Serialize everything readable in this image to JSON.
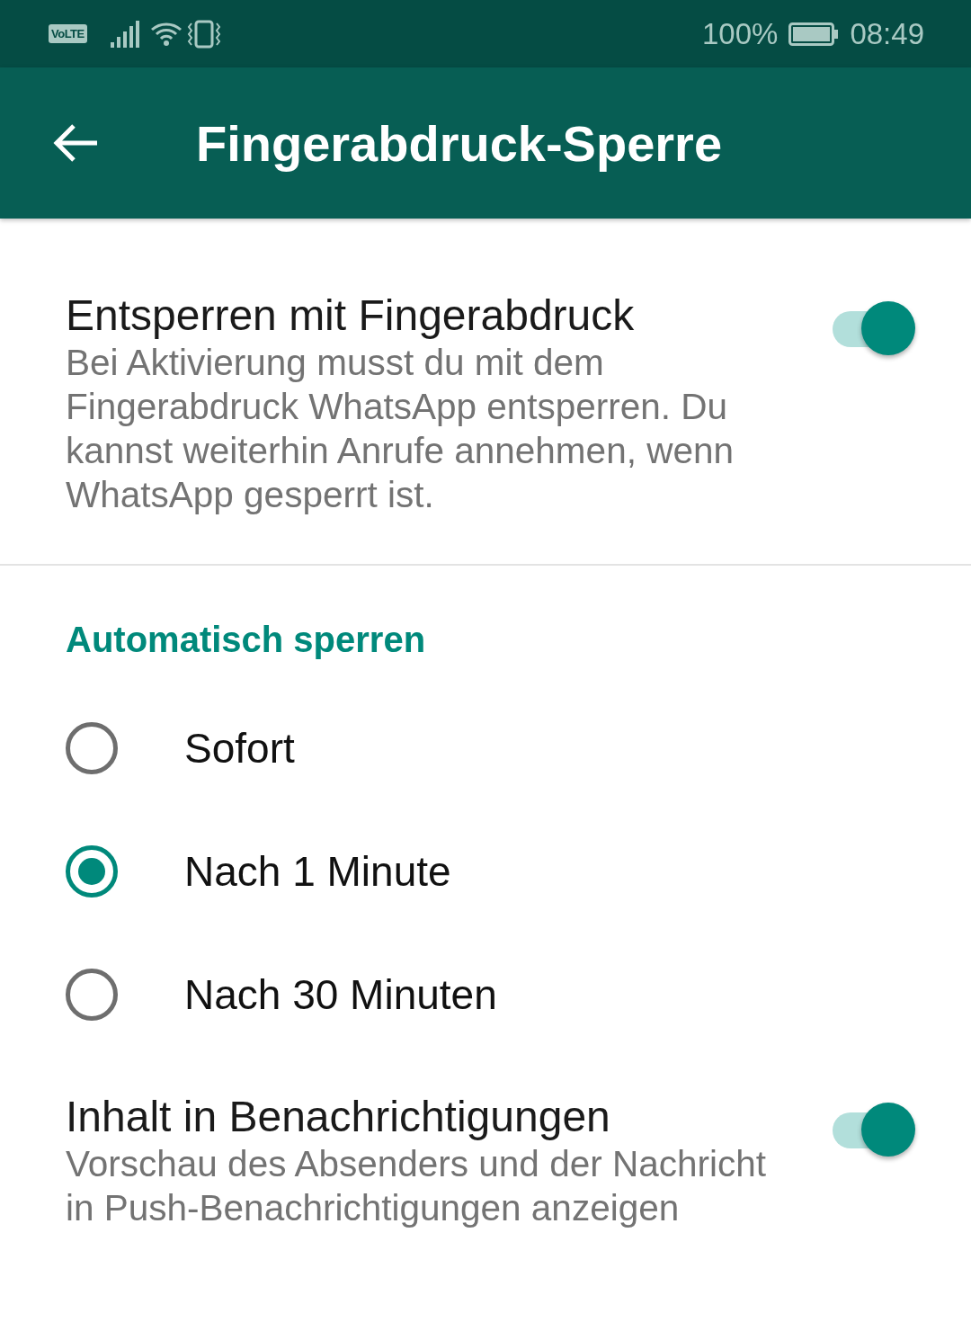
{
  "status_bar": {
    "network_badge": "VoLTE",
    "battery": "100%",
    "time": "08:49"
  },
  "app_bar": {
    "title": "Fingerabdruck-Sperre"
  },
  "settings": [
    {
      "title": "Entsperren mit Fingerabdruck",
      "description": "Bei Aktivierung musst du mit dem Fingerabdruck WhatsApp entsperren. Du kannst weiterhin Anrufe annehmen, wenn WhatsApp gesperrt ist.",
      "on": true
    }
  ],
  "auto_lock": {
    "header": "Automatisch sperren",
    "options": [
      {
        "label": "Sofort",
        "selected": false
      },
      {
        "label": "Nach 1 Minute",
        "selected": true
      },
      {
        "label": "Nach 30 Minuten",
        "selected": false
      }
    ]
  },
  "notification_settings": [
    {
      "title": "Inhalt in Benachrichtigungen",
      "description": "Vorschau des Absenders und der Nachricht in Push-Benachrichtigungen anzeigen",
      "on": true
    }
  ]
}
